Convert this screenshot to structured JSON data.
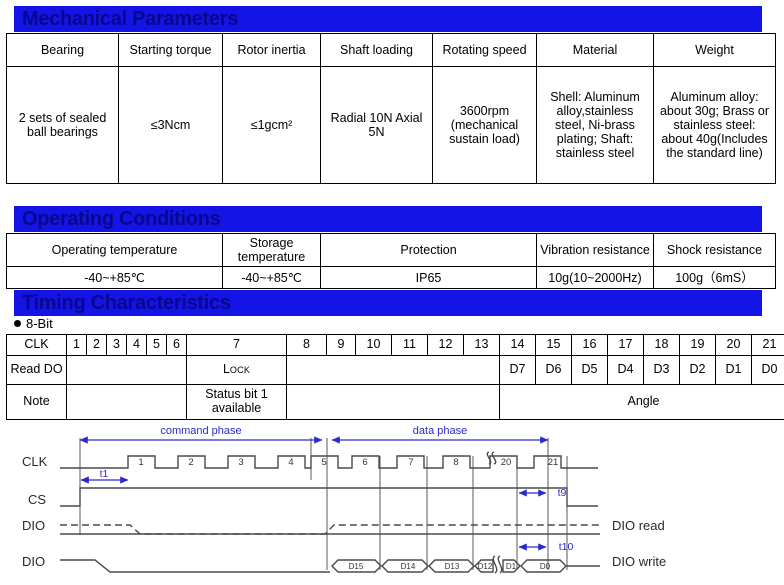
{
  "sections": {
    "mechanical_title": "Mechanical Parameters",
    "operating_title": "Operating Conditions",
    "timing_title": "Timing Characteristics"
  },
  "colors": {
    "header_bar_blue": "#1414e6",
    "header_text_blue": "#08088c",
    "waveform_accent": "#2a2acd",
    "waveform_line": "#4a4a4a"
  },
  "mechanical_table": {
    "headers": [
      "Bearing",
      "Starting torque",
      "Rotor inertia",
      "Shaft loading",
      "Rotating speed",
      "Material",
      "Weight"
    ],
    "values": [
      "2 sets of sealed ball bearings",
      "≤3Ncm",
      "≤1gcm²",
      "Radial 10N Axial 5N",
      "3600rpm (mechanical sustain load)",
      "Shell: Aluminum alloy,stainless steel, Ni-brass plating; Shaft: stainless steel",
      "Aluminum alloy: about 30g; Brass or stainless steel: about 40g(Includes the standard line)"
    ]
  },
  "operating_table": {
    "headers": [
      "Operating temperature",
      "Storage temperature",
      "Protection",
      "Vibration resistance",
      "Shock resistance"
    ],
    "values": [
      "-40~+85℃",
      "-40~+85℃",
      "IP65",
      "10g(10~2000Hz)",
      "100g（6mS）"
    ]
  },
  "timing": {
    "bullet_label": "8-Bit",
    "row_labels": {
      "clk": "CLK",
      "read_do": "Read DO",
      "note": "Note"
    },
    "clk_numbers": [
      "1",
      "2",
      "3",
      "4",
      "5",
      "6",
      "7",
      "8",
      "9",
      "10",
      "11",
      "12",
      "13",
      "14",
      "15",
      "16",
      "17",
      "18",
      "19",
      "20",
      "21"
    ],
    "read_do": {
      "lock_label": "L",
      "lock_sub": "OCK",
      "data_bits": [
        "D7",
        "D6",
        "D5",
        "D4",
        "D3",
        "D2",
        "D1",
        "D0"
      ]
    },
    "note": {
      "status_text": "Status bit 1 available",
      "angle_text": "Angle"
    }
  },
  "waveform": {
    "signal_labels": {
      "clk": "CLK",
      "cs": "CS",
      "dio_read_left": "DIO",
      "dio_write_left": "DIO",
      "dio_read_right": "DIO read",
      "dio_write_right": "DIO write"
    },
    "phases": {
      "command": "command phase",
      "data": "data phase"
    },
    "timing_marks": {
      "t1": "t1",
      "t9": "t9",
      "t10": "t10"
    },
    "clk_pulse_numbers": [
      "1",
      "2",
      "3",
      "4",
      "5",
      "6",
      "7",
      "8",
      "20",
      "21"
    ],
    "dio_write_bits": [
      "D15",
      "D14",
      "D13",
      "D12",
      "D1",
      "D0"
    ]
  }
}
